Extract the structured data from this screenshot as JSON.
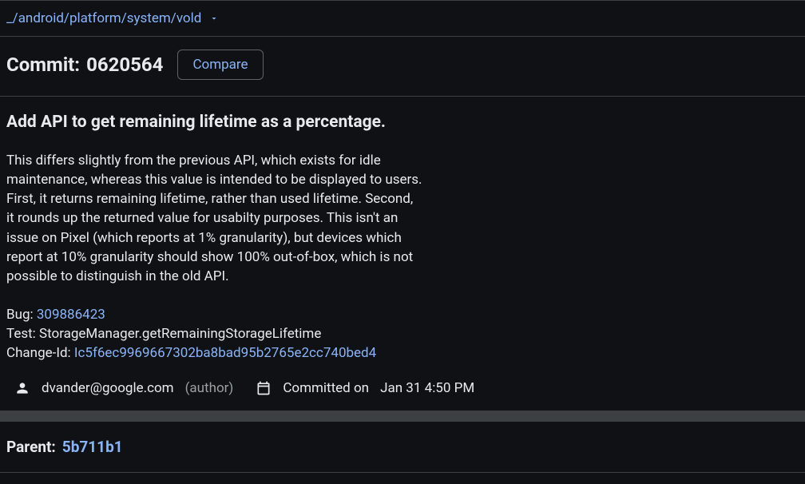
{
  "breadcrumb": {
    "underscore": "_",
    "parts": [
      "android",
      "platform",
      "system",
      "vold"
    ]
  },
  "commit": {
    "label": "Commit:",
    "hash": "0620564",
    "compare": "Compare"
  },
  "message": {
    "title": "Add API to get remaining lifetime as a percentage.",
    "body": "This differs slightly from the previous API, which exists for idle\nmaintenance, whereas this value is intended to be displayed to users.\nFirst, it returns remaining lifetime, rather than used lifetime. Second,\nit rounds up the returned value for usabilty purposes. This isn't an\nissue on Pixel (which reports at 1% granularity), but devices which\nreport at 10% granularity should show 100% out-of-box, which is not\npossible to distinguish in the old API.",
    "bug_label": "Bug: ",
    "bug_id": "309886423",
    "test_line": "Test: StorageManager.getRemainingStorageLifetime",
    "changeid_label": "Change-Id: ",
    "changeid": "Ic5f6ec9969667302ba8bad95b2765e2cc740bed4"
  },
  "meta": {
    "email": "dvander@google.com",
    "author_label": "(author)",
    "committed_label": "Committed on",
    "date": "Jan 31 4:50 PM"
  },
  "parent": {
    "label": "Parent:",
    "hash": "5b711b1"
  }
}
